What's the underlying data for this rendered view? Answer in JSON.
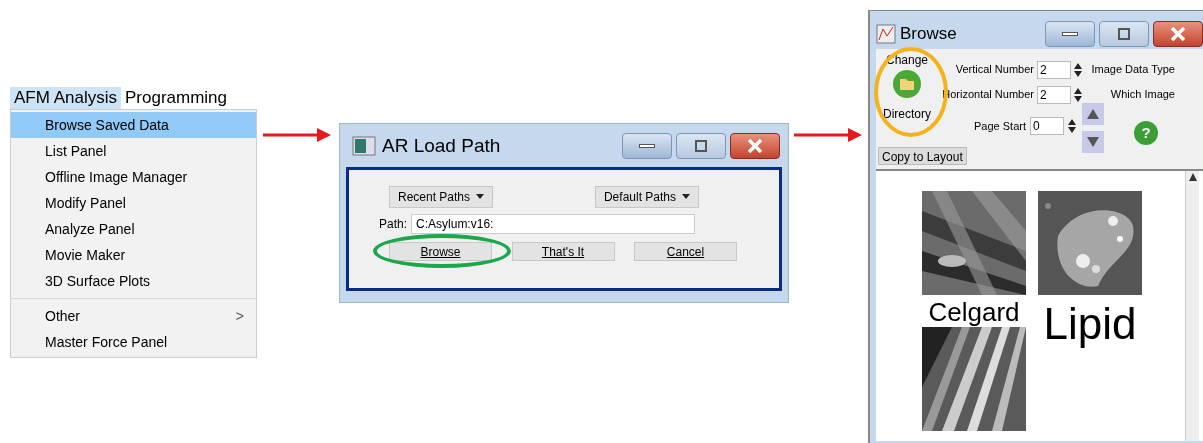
{
  "menu": {
    "bar": [
      {
        "label": "AFM Analysis",
        "selected": true
      },
      {
        "label": "Programming",
        "selected": false
      }
    ],
    "groups": [
      [
        {
          "label": "Browse Saved Data",
          "selected": true,
          "kind": "item"
        },
        {
          "label": "List Panel",
          "selected": false,
          "kind": "item"
        },
        {
          "label": "Offline Image Manager",
          "selected": false,
          "kind": "item"
        },
        {
          "label": "Modify Panel",
          "selected": false,
          "kind": "item"
        },
        {
          "label": "Analyze Panel",
          "selected": false,
          "kind": "item"
        },
        {
          "label": "Movie Maker",
          "selected": false,
          "kind": "item"
        },
        {
          "label": "3D Surface Plots",
          "selected": false,
          "kind": "item"
        }
      ],
      [
        {
          "label": "Other",
          "selected": false,
          "kind": "submenu",
          "arrow": ">"
        },
        {
          "label": "Master Force Panel",
          "selected": false,
          "kind": "item"
        }
      ]
    ]
  },
  "load_path": {
    "title": "AR Load Path",
    "dropdowns": [
      "Recent Paths",
      "Default Paths"
    ],
    "path_label": "Path:",
    "path_value": "C:Asylum:v16:",
    "buttons": [
      {
        "label": "Browse",
        "highlighted": true
      },
      {
        "label": "That's It",
        "highlighted": false
      },
      {
        "label": "Cancel",
        "highlighted": false
      }
    ]
  },
  "browse": {
    "title": "Browse",
    "change_top": "Change",
    "change_bottom": "Directory",
    "fields": [
      {
        "label": "Vertical Number",
        "value": "2",
        "note": "Image Data Type"
      },
      {
        "label": "Horizontal Number",
        "value": "2",
        "note": "Which Image"
      }
    ],
    "page_start": {
      "label": "Page Start",
      "value": "0"
    },
    "copy_button": "Copy to Layout",
    "help": "?",
    "thumbs": [
      {
        "label": "Celgard",
        "kind": "fibers"
      },
      {
        "label": "Lipid",
        "kind": "islands"
      },
      {
        "kind": "stripes"
      }
    ]
  }
}
